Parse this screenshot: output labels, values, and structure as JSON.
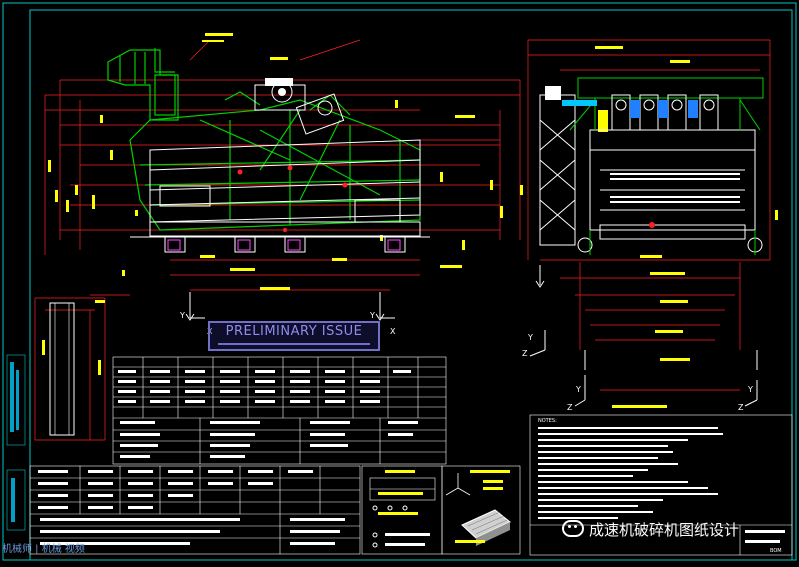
{
  "drawing": {
    "stamp_text": "PRELIMINARY ISSUE",
    "notes_heading": "NOTES:",
    "axis_labels": {
      "x": "X",
      "y": "Y",
      "z": "Z"
    },
    "sheet_code": "BOM",
    "watermark_main": "成速机破碎机图纸设计",
    "watermark_left": "机械师 | 机械 视频"
  },
  "colors": {
    "background": "#000000",
    "border": "#00c8c8",
    "frame": "#ff2020",
    "machine": "#00d000",
    "annotation": "#ffff00",
    "text": "#ffffff",
    "stamp": "#7070c8"
  }
}
